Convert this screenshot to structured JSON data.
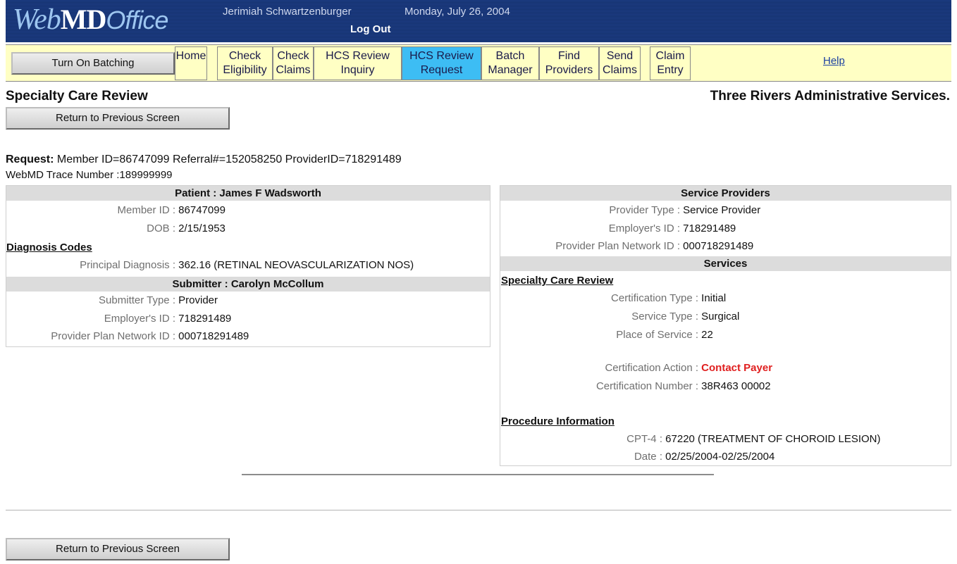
{
  "header": {
    "logo_web": "Web",
    "logo_md": "MD",
    "logo_office": "Office",
    "user": "Jerimiah Schwartzenburger",
    "date": "Monday, July 26, 2004",
    "logout": "Log Out"
  },
  "nav": {
    "batching_button": "Turn On Batching",
    "items": [
      {
        "line1": "Home",
        "line2": ""
      },
      {
        "line1": "Check",
        "line2": "Eligibility"
      },
      {
        "line1": "Check",
        "line2": "Claims"
      },
      {
        "line1": "HCS Review",
        "line2": "Inquiry"
      },
      {
        "line1": "HCS Review",
        "line2": "Request"
      },
      {
        "line1": "Batch",
        "line2": "Manager"
      },
      {
        "line1": "Find",
        "line2": "Providers"
      },
      {
        "line1": "Send",
        "line2": "Claims"
      },
      {
        "line1": "Claim",
        "line2": "Entry"
      }
    ],
    "help": "Help"
  },
  "page": {
    "title": "Specialty Care Review",
    "payer": "Three Rivers Administrative Services.",
    "return_button": "Return to Previous Screen",
    "request_label": "Request:",
    "request_text": " Member ID=86747099 Referral#=152058250 ProviderID=718291489",
    "trace": "WebMD Trace Number :189999999"
  },
  "left": {
    "patient_head": "Patient : James F Wadsworth",
    "member_id_label": "Member ID :",
    "member_id": " 86747099",
    "dob_label": "DOB :",
    "dob": " 2/15/1953",
    "diagnosis_head": "Diagnosis Codes",
    "principal_label": "Principal Diagnosis :",
    "principal": " 362.16 (RETINAL NEOVASCULARIZATION NOS)",
    "submitter_head": "Submitter : Carolyn McCollum",
    "submitter_type_label": "Submitter Type :",
    "submitter_type": " Provider",
    "employer_label": "Employer's ID :",
    "employer": " 718291489",
    "network_label": "Provider Plan Network ID :",
    "network": " 000718291489"
  },
  "right": {
    "providers_head": "Service Providers",
    "provider_type_label": "Provider Type :",
    "provider_type": " Service Provider",
    "employer_label": "Employer's ID :",
    "employer": " 718291489",
    "network_label": "Provider Plan Network ID :",
    "network": " 000718291489",
    "services_head": "Services",
    "scr_head": "Specialty Care Review",
    "cert_type_label": "Certification Type :",
    "cert_type": " Initial",
    "service_type_label": "Service Type :",
    "service_type": " Surgical",
    "place_label": "Place of Service :",
    "place": " 22",
    "action_label": "Certification Action :",
    "action": " Contact Payer",
    "cert_number_label": "Certification Number :",
    "cert_number": " 38R463 00002",
    "procedure_head": "Procedure Information",
    "cpt_label": "CPT-4 :",
    "cpt": " 67220 (TREATMENT OF CHOROID LESION)",
    "date_label": "Date :",
    "date": " 02/25/2004-02/25/2004"
  },
  "colors": {
    "banner": "#1d3e86",
    "navbar": "#ffffc4",
    "active_tab": "#3dbdf4",
    "alert": "#e02020"
  }
}
